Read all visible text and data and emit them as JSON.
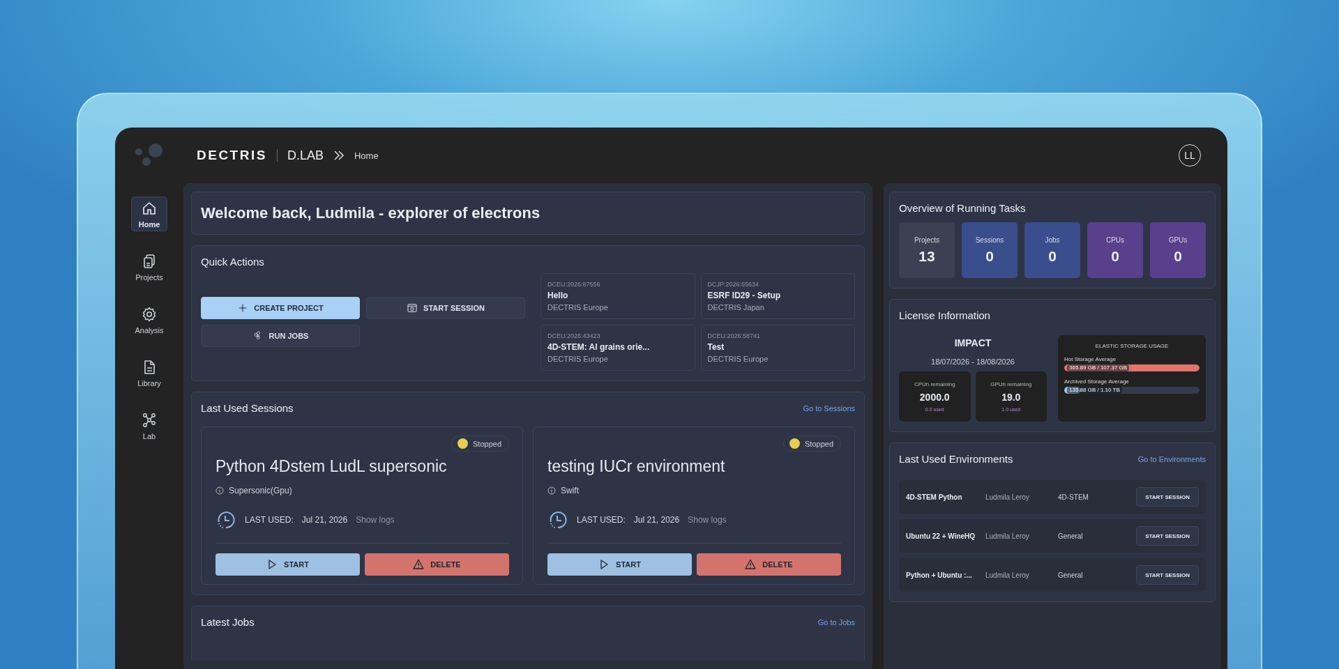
{
  "header": {
    "brand": "DECTRIS",
    "product": "D.LAB",
    "breadcrumb": "Home",
    "avatar": "LL"
  },
  "sidebar": {
    "items": [
      {
        "label": "Home",
        "selected": true
      },
      {
        "label": "Projects",
        "selected": false
      },
      {
        "label": "Analysis",
        "selected": false
      },
      {
        "label": "Library",
        "selected": false
      },
      {
        "label": "Lab",
        "selected": false
      }
    ]
  },
  "welcome": {
    "title": "Welcome back, Ludmila - explorer of electrons"
  },
  "quick_actions": {
    "title": "Quick Actions",
    "buttons": [
      {
        "label": "CREATE PROJECT",
        "kind": "primary"
      },
      {
        "label": "START SESSION",
        "kind": "secondary"
      },
      {
        "label": "RUN JOBS",
        "kind": "secondary"
      }
    ],
    "projects": [
      {
        "id": "DCEU:2026:87556",
        "name": "Hello",
        "org": "DECTRIS Europe"
      },
      {
        "id": "DCJP:2026:65634",
        "name": "ESRF ID29 - Setup",
        "org": "DECTRIS Japan"
      },
      {
        "id": "DCEU:2026:43423",
        "name": "4D-STEM: Al grains orie...",
        "org": "DECTRIS Europe"
      },
      {
        "id": "DCEU:2026:58741",
        "name": "Test",
        "org": "DECTRIS Europe"
      }
    ]
  },
  "sessions": {
    "title": "Last Used Sessions",
    "link": "Go to Sessions",
    "items": [
      {
        "status": "Stopped",
        "color": "#e6cf4c",
        "name": "Python 4Dstem LudL supersonic",
        "environment": "Supersonic(Gpu)",
        "last_used_label": "LAST USED:",
        "date": "Jul 21, 2026",
        "logs": "Show logs",
        "start": "START",
        "delete": "DELETE"
      },
      {
        "status": "Stopped",
        "color": "#e6cf4c",
        "name": "testing IUCr environment",
        "environment": "Swift",
        "last_used_label": "LAST USED:",
        "date": "Jul 21, 2026",
        "logs": "Show logs",
        "start": "START",
        "delete": "DELETE"
      }
    ]
  },
  "jobs": {
    "title": "Latest Jobs",
    "link": "Go to Jobs"
  },
  "overview": {
    "title": "Overview of Running Tasks",
    "tiles": [
      {
        "label": "Projects",
        "value": "13",
        "color": "#3a4152"
      },
      {
        "label": "Sessions",
        "value": "0",
        "color": "#3a4d8c"
      },
      {
        "label": "Jobs",
        "value": "0",
        "color": "#3a4d8c"
      },
      {
        "label": "CPUs",
        "value": "0",
        "color": "#59408c"
      },
      {
        "label": "GPUs",
        "value": "0",
        "color": "#59408c"
      }
    ]
  },
  "license": {
    "title": "License Information",
    "plan": "IMPACT",
    "period": "18/07/2026 - 18/08/2026",
    "quotas": [
      {
        "label": "CPUh remaining",
        "value": "2000.0",
        "used": "0.0 used"
      },
      {
        "label": "GPUh remaining",
        "value": "19.0",
        "used": "1.0 used"
      }
    ],
    "storage": {
      "title": "ELASTIC STORAGE USAGE",
      "bars": [
        {
          "label": "Hot Storage Average",
          "reading": "365.89 GB / 107.37 GB",
          "level": 1,
          "color": "#e0756c"
        },
        {
          "label": "Archived Storage Average",
          "reading": "135.88 GB / 1.10 TB",
          "level": 0.12,
          "color": "#9cc9f0"
        }
      ]
    }
  },
  "environments": {
    "title": "Last Used Environments",
    "link": "Go to Environments",
    "rows": [
      {
        "name": "4D-STEM Python",
        "owner": "Ludmila Leroy",
        "category": "4D-STEM",
        "button": "START SESSION"
      },
      {
        "name": "Ubuntu 22 + WineHQ",
        "owner": "Ludmila Leroy",
        "category": "General",
        "button": "START SESSION"
      },
      {
        "name": "Python + Ubuntu :...",
        "owner": "Ludmila Leroy",
        "category": "General",
        "button": "START SESSION"
      }
    ]
  }
}
